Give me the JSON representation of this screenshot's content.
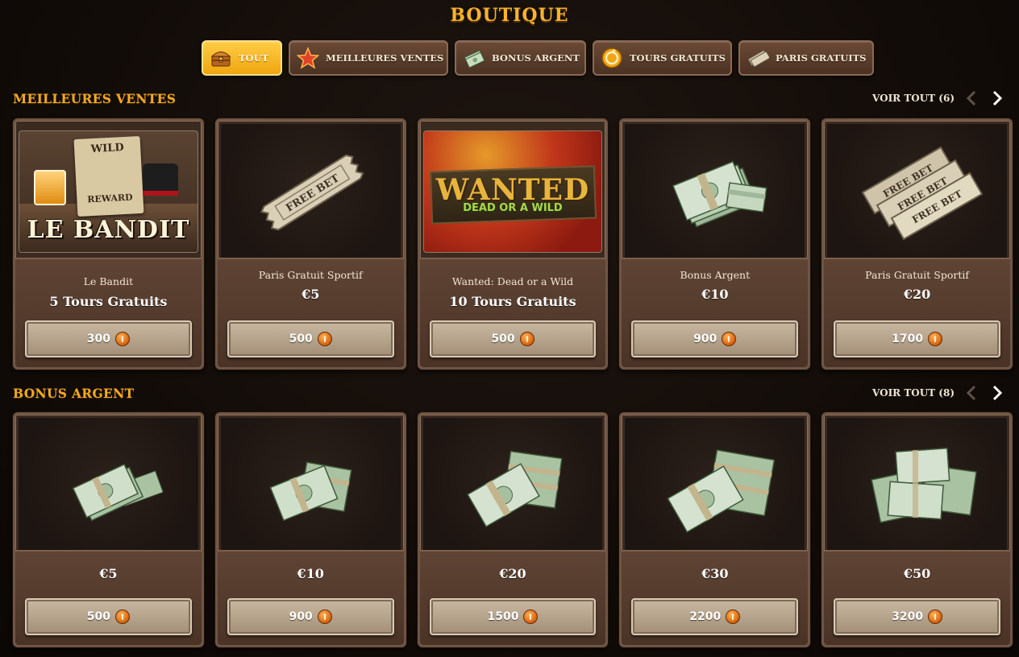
{
  "page_title": "BOUTIQUE",
  "tabs": [
    {
      "label": "TOUT",
      "icon": "treasure-chest-icon",
      "active": true
    },
    {
      "label": "MEILLEURES VENTES",
      "icon": "star-icon",
      "active": false
    },
    {
      "label": "BONUS ARGENT",
      "icon": "cash-icon",
      "active": false
    },
    {
      "label": "TOURS GRATUITS",
      "icon": "spin-coin-icon",
      "active": false
    },
    {
      "label": "PARIS GRATUITS",
      "icon": "ticket-icon",
      "active": false
    }
  ],
  "sections": [
    {
      "title": "MEILLEURES VENTES",
      "voir_tout": "VOIR TOUT (6)",
      "items": [
        {
          "name": "Le Bandit",
          "value": "5 Tours Gratuits",
          "price": "300",
          "art": "game-le-bandit",
          "art_text": {
            "poster_top": "WILD",
            "poster_bottom": "REWARD",
            "logo": "LE BANDIT"
          }
        },
        {
          "name": "Paris Gratuit Sportif",
          "value": "€5",
          "price": "500",
          "art": "free-bet-ticket"
        },
        {
          "name": "Wanted: Dead or a Wild",
          "value": "10 Tours Gratuits",
          "price": "500",
          "art": "game-wanted",
          "art_text": {
            "logo_top": "WANTED",
            "logo_bottom": "DEAD OR A WILD"
          }
        },
        {
          "name": "Bonus Argent",
          "value": "€10",
          "price": "900",
          "art": "cash-stack"
        },
        {
          "name": "Paris Gratuit Sportif",
          "value": "€20",
          "price": "1700",
          "art": "free-bet-tickets"
        }
      ]
    },
    {
      "title": "BONUS ARGENT",
      "voir_tout": "VOIR TOUT (8)",
      "items": [
        {
          "value": "€5",
          "price": "500",
          "art": "cash-stack-small"
        },
        {
          "value": "€10",
          "price": "900",
          "art": "cash-stack"
        },
        {
          "value": "€20",
          "price": "1500",
          "art": "cash-stack-medium"
        },
        {
          "value": "€30",
          "price": "2200",
          "art": "cash-stack-large"
        },
        {
          "value": "€50",
          "price": "3200",
          "art": "cash-pile"
        }
      ]
    }
  ],
  "ticket_text": "FREE BET",
  "colors": {
    "accent": "#f7b32b",
    "card_border": "#6e5544",
    "coin": "#d5620c"
  }
}
